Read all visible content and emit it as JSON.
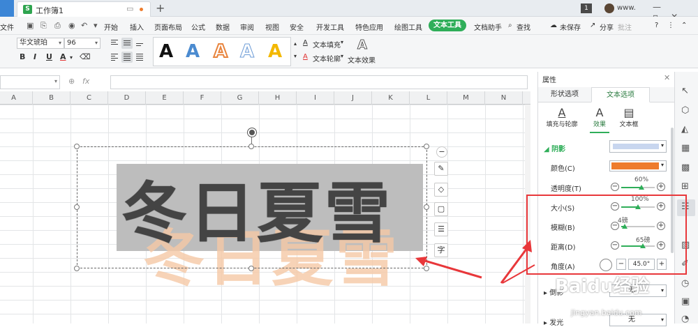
{
  "titlebar": {
    "doc_tab": "工作簿1",
    "s_badge": "S",
    "window_num": "1",
    "user": "www.",
    "add_tab": "+",
    "win_controls": "—▫✕"
  },
  "menubar": {
    "file": "文件",
    "items": [
      "开始",
      "插入",
      "页面布局",
      "公式",
      "数据",
      "审阅",
      "视图",
      "安全",
      "开发工具",
      "特色应用",
      "绘图工具",
      "文本工具",
      "文档助手"
    ],
    "search": "查找",
    "save_state": "未保存",
    "share": "分享",
    "annotate": "批注",
    "help": "?"
  },
  "toolbar": {
    "font_name": "华文琥珀",
    "font_size": "96",
    "bold": "B",
    "italic": "I",
    "underline": "U",
    "font_color": "A",
    "art_letters": [
      "A",
      "A",
      "A",
      "A",
      "A"
    ],
    "text_fill": "文本填充",
    "text_outline": "文本轮廓",
    "text_effect": "文本效果"
  },
  "formulabar": {
    "fx": "fx",
    "zoom_icon": "⊕"
  },
  "grid": {
    "columns": [
      "A",
      "B",
      "C",
      "D",
      "E",
      "F",
      "G",
      "H",
      "I",
      "J",
      "K",
      "L",
      "M",
      "N"
    ],
    "wordart_text": "冬日夏雪"
  },
  "panel": {
    "title": "属性",
    "tabs": [
      "形状选项",
      "文本选项"
    ],
    "subtabs": [
      "填充与轮廓",
      "效果",
      "文本框"
    ],
    "section_shadow": "阴影",
    "color_label": "颜色(C)",
    "rows": [
      {
        "label": "透明度(T)",
        "value": "60%",
        "fraction": 0.6
      },
      {
        "label": "大小(S)",
        "value": "100%",
        "fraction": 0.5
      },
      {
        "label": "模糊(B)",
        "value": "4磅",
        "fraction": 0.1
      },
      {
        "label": "距离(D)",
        "value": "65磅",
        "fraction": 0.65
      }
    ],
    "angle_label": "角度(A)",
    "angle_value": "45.0°",
    "reflection_label": "倒影",
    "reflection_value": "无",
    "glow_label": "发光",
    "glow_value": "无"
  },
  "watermark": {
    "text": "Baidu经验",
    "sub": "jingyan.baidu.com"
  },
  "colors": {
    "accent": "#2fae59",
    "shadow_color": "#ee7c2d",
    "highlight": "#e8373a"
  }
}
